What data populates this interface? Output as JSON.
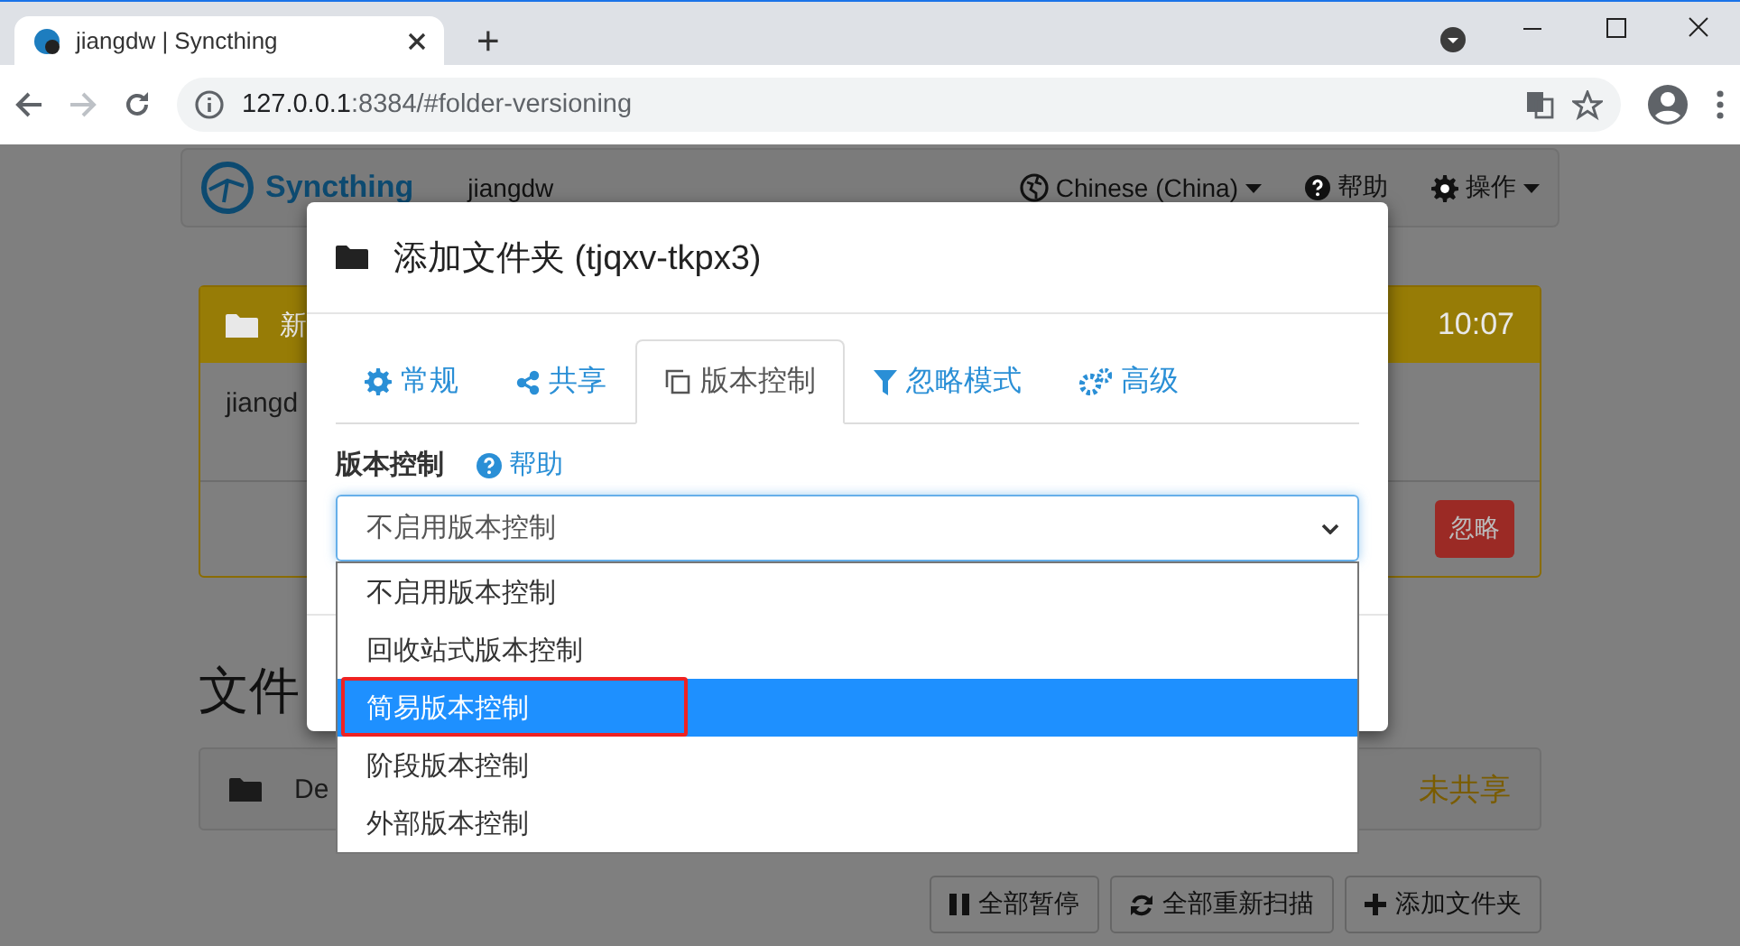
{
  "browser": {
    "tab_title": "jiangdw | Syncthing",
    "new_tab": "+",
    "url_host": "127.0.0.1",
    "url_rest": ":8384/#folder-versioning"
  },
  "page": {
    "navbar": {
      "brand": "Syncthing",
      "device": "jiangdw",
      "language": "Chinese (China)",
      "help": "帮助",
      "actions": "操作"
    },
    "notice": {
      "title": "新",
      "time": "10:07",
      "body": "jiangd",
      "ignore_button": "忽略"
    },
    "folders_heading": "文件",
    "folders": [
      {
        "name": "De",
        "status": "未共享"
      }
    ],
    "buttons": [
      "全部暂停",
      "全部重新扫描",
      "添加文件夹"
    ]
  },
  "modal": {
    "title": "添加文件夹 (tjqxv-tkpx3)",
    "tabs": [
      {
        "label": "常规",
        "selected": false
      },
      {
        "label": "共享",
        "selected": false
      },
      {
        "label": "版本控制",
        "selected": true
      },
      {
        "label": "忽略模式",
        "selected": false
      },
      {
        "label": "高级",
        "selected": false
      }
    ],
    "field_label": "版本控制",
    "help_link": "帮助",
    "select": {
      "value": "不启用版本控制",
      "expanded": true
    },
    "options": [
      {
        "label": "不启用版本控制",
        "selected": false
      },
      {
        "label": "回收站式版本控制",
        "selected": false
      },
      {
        "label": "简易版本控制",
        "selected": true
      },
      {
        "label": "阶段版本控制",
        "selected": false
      },
      {
        "label": "外部版本控制",
        "selected": false
      }
    ]
  }
}
